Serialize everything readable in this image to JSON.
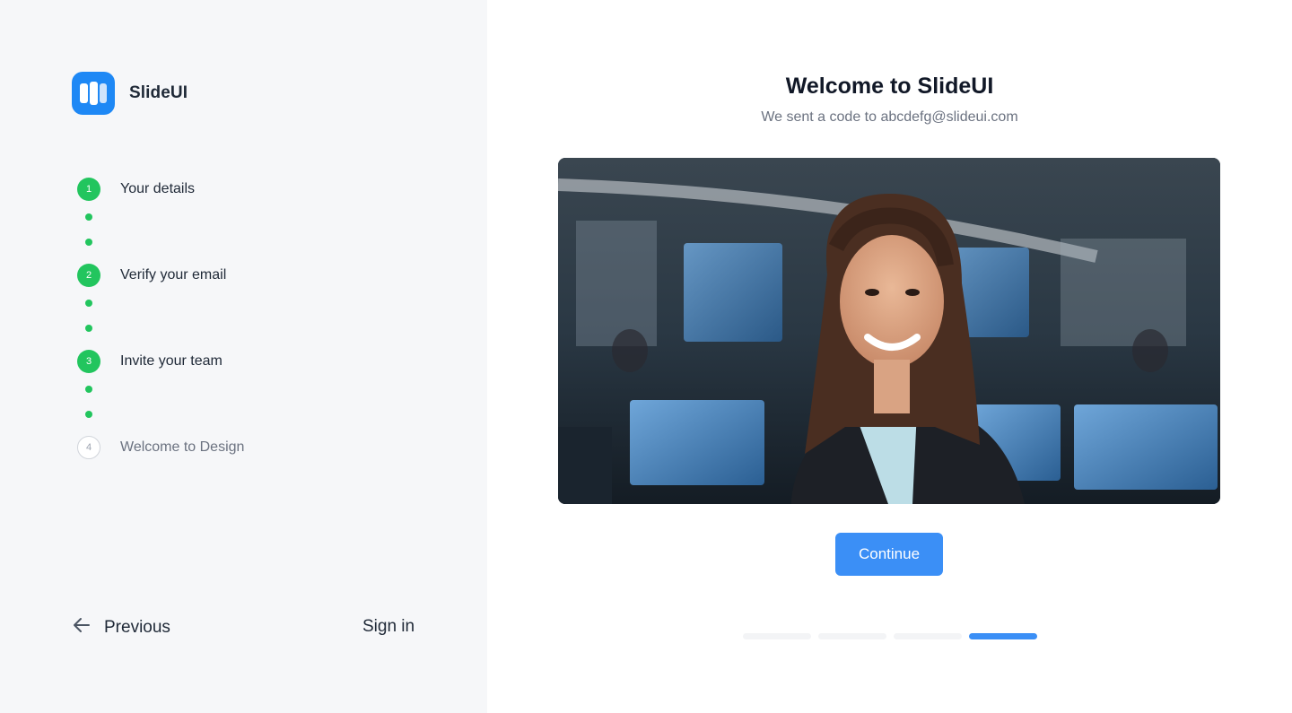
{
  "brand": {
    "name": "SlideUI",
    "logo_icon": "slideui-logo-icon",
    "color": "#1e88f5"
  },
  "steps": [
    {
      "number": "1",
      "label": "Your details",
      "status": "complete"
    },
    {
      "number": "2",
      "label": "Verify your email",
      "status": "complete"
    },
    {
      "number": "3",
      "label": "Invite your team",
      "status": "complete"
    },
    {
      "number": "4",
      "label": "Welcome to Design",
      "status": "pending"
    }
  ],
  "nav": {
    "previous_label": "Previous",
    "previous_icon": "arrow-left-icon",
    "sign_in_label": "Sign in"
  },
  "main": {
    "title": "Welcome to SlideUI",
    "subtitle": "We sent a code to abcdefg@slideui.com",
    "hero_image": "woman-in-office-photo",
    "continue_label": "Continue"
  },
  "progress": {
    "total_steps": 4,
    "current_step": 4
  },
  "colors": {
    "accent": "#3b8ff6",
    "step_complete": "#22c55e",
    "left_panel_bg": "#f6f7f9"
  }
}
